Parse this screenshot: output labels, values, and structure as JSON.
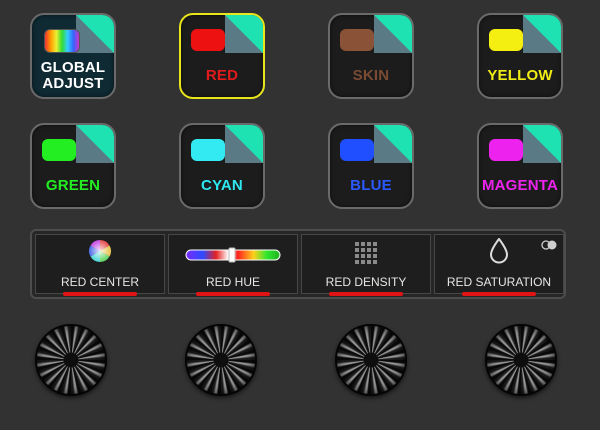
{
  "buttons": [
    {
      "id": "global-adjust",
      "line1": "GLOBAL",
      "line2": "ADJUST",
      "text_color": "#ffffff",
      "swatch": "rainbow"
    },
    {
      "id": "red",
      "label": "RED",
      "text_color": "#e11b1b",
      "swatch_color": "#ee1111",
      "selected": true
    },
    {
      "id": "skin",
      "label": "SKIN",
      "text_color": "#7a4b33",
      "swatch_color": "#8a5236"
    },
    {
      "id": "yellow",
      "label": "YELLOW",
      "text_color": "#f0ec16",
      "swatch_color": "#f4ef10"
    },
    {
      "id": "green",
      "label": "GREEN",
      "text_color": "#22ee22",
      "swatch_color": "#22ee22"
    },
    {
      "id": "cyan",
      "label": "CYAN",
      "text_color": "#2ee8f0",
      "swatch_color": "#33eaf2"
    },
    {
      "id": "blue",
      "label": "BLUE",
      "text_color": "#2a59ff",
      "swatch_color": "#1f4fff"
    },
    {
      "id": "magenta",
      "label": "MAGENTA",
      "text_color": "#ee22ee",
      "swatch_color": "#ee22ee"
    }
  ],
  "controls": [
    {
      "id": "center",
      "label": "RED CENTER",
      "icon": "color-wheel-icon"
    },
    {
      "id": "hue",
      "label": "RED HUE",
      "icon": "hue-slider-icon",
      "hue_position": 0.4
    },
    {
      "id": "density",
      "label": "RED DENSITY",
      "icon": "density-grid-icon"
    },
    {
      "id": "saturation",
      "label": "RED SATURATION",
      "icon": "droplet-icon"
    }
  ],
  "colors": {
    "accent_bar": "#e01414",
    "selected_border": "#e8e51b",
    "corner_teal": "#1ee2b2",
    "corner_fold": "#5a7a86"
  }
}
